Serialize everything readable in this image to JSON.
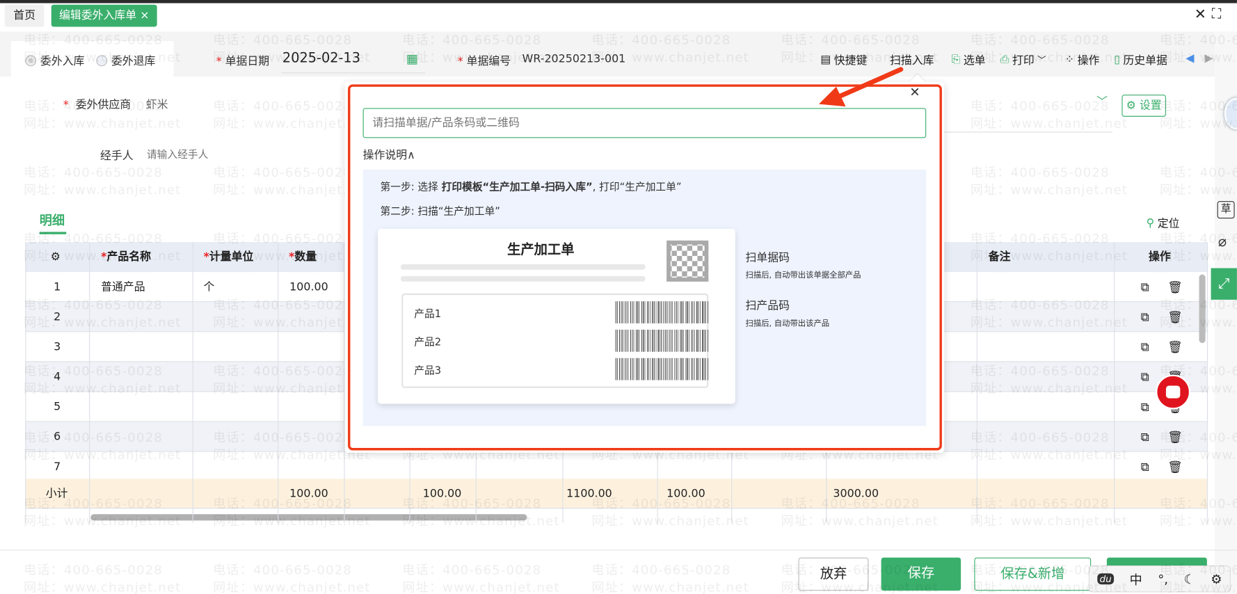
{
  "tabs": {
    "home": "首页",
    "active": "编辑委外入库单",
    "active_close": "×"
  },
  "window": {
    "close": "✕",
    "fullscreen": "⛶"
  },
  "form": {
    "radio_in": "委外入库",
    "radio_return": "委外退库",
    "date_label": "单据日期",
    "date_value": "2025-02-13",
    "code_label": "单据编号",
    "code_value": "WR-20250213-001",
    "supplier_label": "委外供应商",
    "supplier_value": "虾米",
    "handler_label": "经手人",
    "handler_placeholder": "请输入经手人",
    "settings": "设置",
    "required_mark": "*"
  },
  "toolbar": {
    "shortcut": "快捷键",
    "scan_in": "扫描入库",
    "select": "选单",
    "print": "打印",
    "operate": "操作",
    "history": "历史单据"
  },
  "detail": {
    "tab": "明细",
    "locate": "定位"
  },
  "table": {
    "headers": {
      "name": "产品名称",
      "unit": "计量单位",
      "qty": "数量",
      "remark": "备注",
      "ops": "操作"
    },
    "rows": [
      {
        "no": "1",
        "name": "普通产品",
        "unit": "个",
        "qty": "100.00"
      },
      {
        "no": "2",
        "name": "",
        "unit": "",
        "qty": ""
      },
      {
        "no": "3",
        "name": "",
        "unit": "",
        "qty": ""
      },
      {
        "no": "4",
        "name": "",
        "unit": "",
        "qty": ""
      },
      {
        "no": "5",
        "name": "",
        "unit": "",
        "qty": ""
      },
      {
        "no": "6",
        "name": "",
        "unit": "",
        "qty": ""
      },
      {
        "no": "7",
        "name": "",
        "unit": "",
        "qty": ""
      }
    ],
    "subtotal": {
      "label": "小计",
      "qty": "100.00",
      "c5": "100.00",
      "c7": "1100.00",
      "c8": "100.00",
      "c10": "3000.00"
    }
  },
  "modal": {
    "close": "✕",
    "scan_placeholder": "请扫描单据/产品条码或二维码",
    "instructions_toggle": "操作说明∧",
    "step1_prefix": "第一步: 选择 ",
    "step1_bold": "打印模板“生产加工单-扫码入库”",
    "step1_suffix": ", 打印“生产加工单”",
    "step2": "第二步: 扫描“生产加工单”",
    "card_title": "生产加工单",
    "products": [
      "产品1",
      "产品2",
      "产品3"
    ],
    "scan_doc_title": "扫单据码",
    "scan_doc_desc": "扫描后, 自动带出该单据全部产品",
    "scan_prod_title": "扫产品码",
    "scan_prod_desc": "扫描后, 自动带出该产品"
  },
  "footer": {
    "discard": "放弃",
    "save": "保存",
    "save_new": "保存&新增"
  },
  "ime": {
    "logo": "du",
    "mode": "中",
    "punct": "°,",
    "moon": "☾",
    "gear": "⚙"
  },
  "side": {
    "draft": "草"
  },
  "watermark": {
    "phone": "电话：400-665-0028",
    "site": "网址：www.chanjet.net"
  },
  "colors": {
    "accent": "#3aaf6c",
    "highlight": "#f03a17",
    "header_bg": "#e8ecf4",
    "subtotal_bg": "#fdf1de"
  }
}
